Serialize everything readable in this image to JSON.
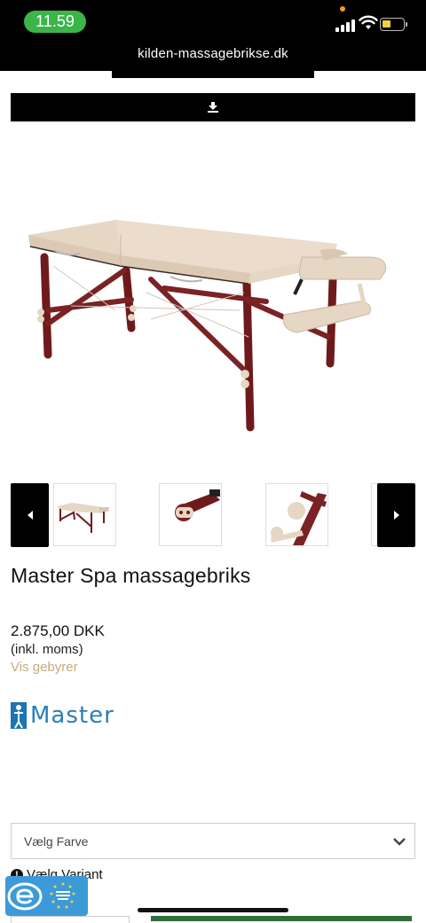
{
  "status_bar": {
    "time": "11.59",
    "url": "kilden-massagebrikse.dk"
  },
  "toolbar": {
    "download_icon": "download-icon"
  },
  "gallery": {
    "main_image": "massage-table",
    "thumbnails": [
      "massage-table",
      "head-rest-detail",
      "leg-knob-detail"
    ],
    "prev_icon": "chevron-left-icon",
    "next_icon": "chevron-right-icon"
  },
  "product": {
    "title": "Master Spa massagebriks",
    "price": "2.875,00 DKK",
    "vat_note": "(inkl. moms)",
    "fees_link": "Vis gebyrer",
    "brand": "Master"
  },
  "options": {
    "color_select": "Vælg Farve",
    "variant_warning": "Vælg Variant"
  },
  "colors": {
    "accent_link": "#c9a97b",
    "time_pill": "#3bb54a",
    "cart_button": "#2f6d3a",
    "brand_blue": "#2a7fb8",
    "table_cushion": "#e6d6c4",
    "table_wood": "#6e1a1c"
  }
}
